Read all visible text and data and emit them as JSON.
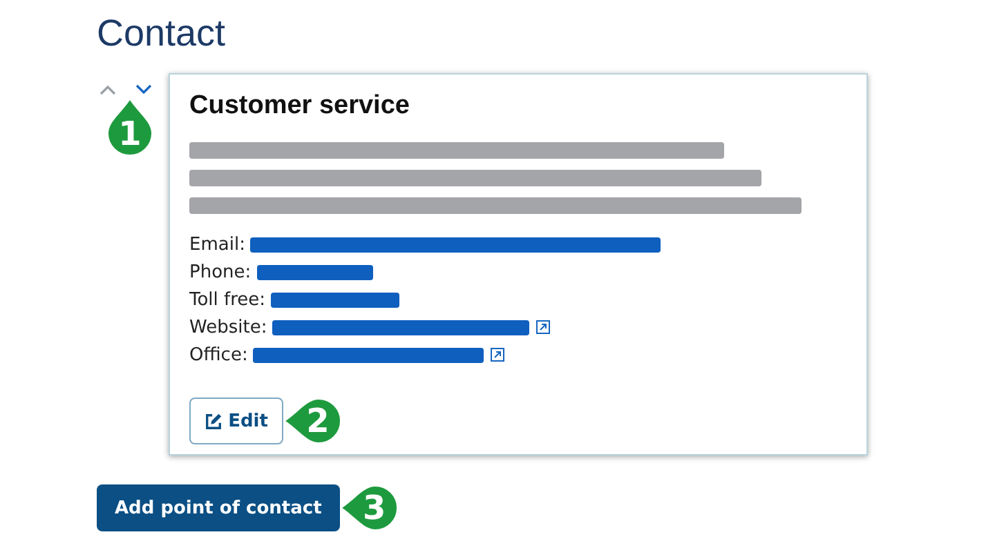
{
  "heading": "Contact",
  "reorder": [
    {
      "kind": "up",
      "disabled": true
    },
    {
      "kind": "down",
      "disabled": false
    }
  ],
  "callouts": [
    "1",
    "2",
    "3"
  ],
  "card": {
    "title": "Customer service",
    "fields": [
      {
        "label": "Email:",
        "external": false
      },
      {
        "label": "Phone:",
        "external": false
      },
      {
        "label": "Toll free:",
        "external": false
      },
      {
        "label": "Website:",
        "external": true
      },
      {
        "label": "Office:",
        "external": true
      }
    ],
    "edit_button": "Edit"
  },
  "add_button": "Add point of contact"
}
